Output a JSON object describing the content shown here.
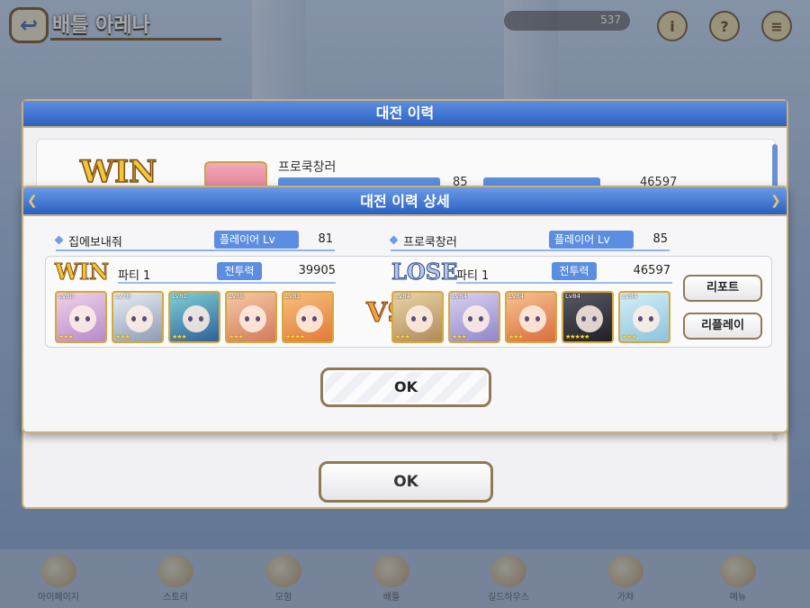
{
  "top": {
    "title": "배틀 아레나",
    "counter": "537"
  },
  "bottom_nav": [
    {
      "label": "마이페이지"
    },
    {
      "label": "스토리"
    },
    {
      "label": "모험"
    },
    {
      "label": "배틀"
    },
    {
      "label": "길드하우스"
    },
    {
      "label": "가챠"
    },
    {
      "label": "메뉴"
    }
  ],
  "history_dialog": {
    "title": "대전 이력",
    "entry": {
      "result": "WIN",
      "opponent_name": "프로쿡창러",
      "level": "85",
      "power": "46597"
    },
    "ok_label": "OK"
  },
  "detail_dialog": {
    "title": "대전 이력 상세",
    "vs_label": "VS",
    "ok_label": "OK",
    "report_label": "리포트",
    "replay_label": "리플레이",
    "left": {
      "player_name": "집에보내줘",
      "level_label": "플레이어 Lv",
      "level": "81",
      "result": "WIN",
      "party_label": "파티 1",
      "power_label": "전투력",
      "power": "39905",
      "units": [
        {
          "lv": "Lv80",
          "stars": "★★★",
          "color_a": "#f1d3ea",
          "color_b": "#b58ac9"
        },
        {
          "lv": "Lv78",
          "stars": "★★★",
          "color_a": "#e8eef5",
          "color_b": "#8e9bb3"
        },
        {
          "lv": "Lv80",
          "stars": "★★★",
          "color_a": "#7fd1d6",
          "color_b": "#2f5f98"
        },
        {
          "lv": "Lv80",
          "stars": "★★★",
          "color_a": "#f7c9a6",
          "color_b": "#d27b5a"
        },
        {
          "lv": "Lv81",
          "stars": "★★★★",
          "color_a": "#f7c07c",
          "color_b": "#e27a3a"
        }
      ]
    },
    "right": {
      "player_name": "프로쿡창러",
      "level_label": "플레이어 Lv",
      "level": "85",
      "result": "LOSE",
      "party_label": "파티 1",
      "power_label": "전투력",
      "power": "46597",
      "units": [
        {
          "lv": "Lv84",
          "stars": "★★★",
          "color_a": "#e9d4a8",
          "color_b": "#b08a5a"
        },
        {
          "lv": "Lv84",
          "stars": "★★★",
          "color_a": "#d9d2f0",
          "color_b": "#8f86c9"
        },
        {
          "lv": "Lv84",
          "stars": "★★★",
          "color_a": "#f7c292",
          "color_b": "#d96e3e"
        },
        {
          "lv": "Lv84",
          "stars": "★★★★★",
          "color_a": "#5a5a66",
          "color_b": "#1f1f26"
        },
        {
          "lv": "Lv84",
          "stars": "★★★",
          "color_a": "#d6eef7",
          "color_b": "#8cc3dc"
        }
      ]
    }
  }
}
